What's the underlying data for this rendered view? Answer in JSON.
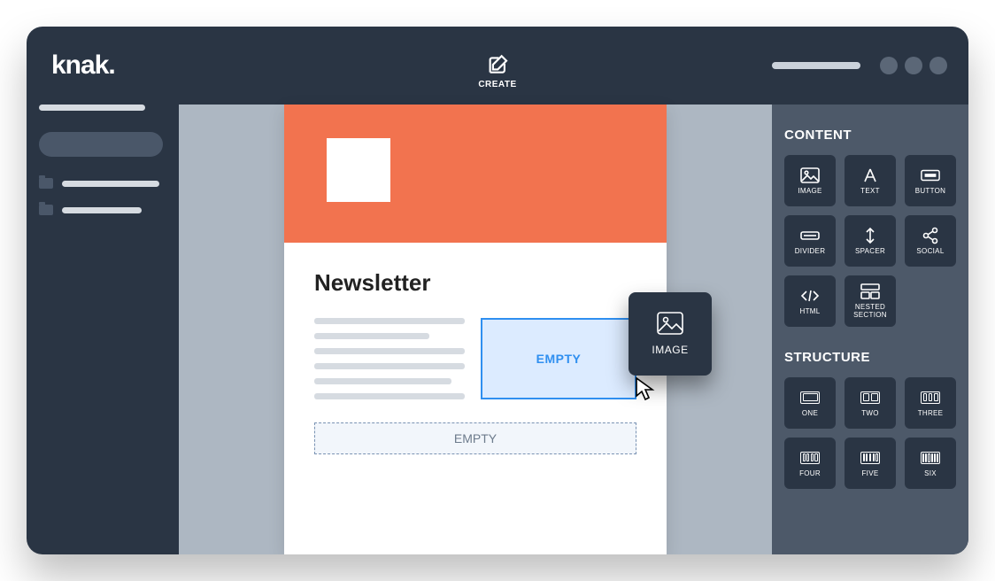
{
  "logo": "knak.",
  "header": {
    "create_label": "CREATE"
  },
  "email": {
    "title": "Newsletter",
    "dropzone_active": "EMPTY",
    "dropzone_empty": "EMPTY"
  },
  "drag": {
    "label": "IMAGE"
  },
  "panel": {
    "content_heading": "CONTENT",
    "structure_heading": "STRUCTURE",
    "content_items": [
      {
        "key": "image",
        "label": "IMAGE"
      },
      {
        "key": "text",
        "label": "TEXT"
      },
      {
        "key": "button",
        "label": "BUTTON"
      },
      {
        "key": "divider",
        "label": "DIVIDER"
      },
      {
        "key": "spacer",
        "label": "SPACER"
      },
      {
        "key": "social",
        "label": "SOCIAL"
      },
      {
        "key": "html",
        "label": "HTML"
      },
      {
        "key": "nested",
        "label": "NESTED\nSECTION"
      }
    ],
    "structure_items": [
      {
        "key": "one",
        "label": "ONE",
        "cols": 1
      },
      {
        "key": "two",
        "label": "TWO",
        "cols": 2
      },
      {
        "key": "three",
        "label": "THREE",
        "cols": 3
      },
      {
        "key": "four",
        "label": "FOUR",
        "cols": 4
      },
      {
        "key": "five",
        "label": "FIVE",
        "cols": 5
      },
      {
        "key": "six",
        "label": "SIX",
        "cols": 6
      }
    ]
  }
}
